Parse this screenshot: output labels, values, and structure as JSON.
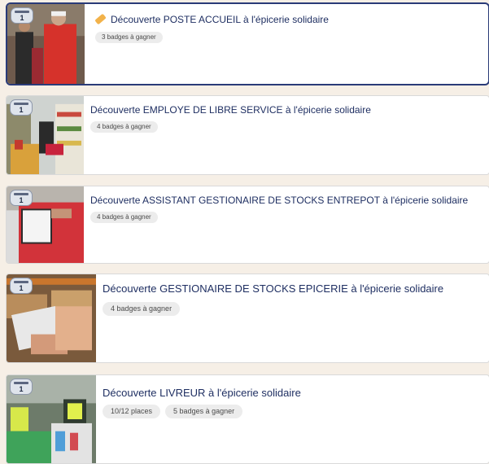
{
  "cards": [
    {
      "title": "Découverte POSTE ACCUEIL à l'épicerie solidaire",
      "session": "1",
      "chips": [
        "3 badges à gagner"
      ]
    },
    {
      "title": "Découverte EMPLOYE DE LIBRE SERVICE à l'épicerie solidaire",
      "session": "1",
      "chips": [
        "4 badges à gagner"
      ]
    },
    {
      "title": "Découverte ASSISTANT GESTIONAIRE DE STOCKS ENTREPOT à l'épicerie solidaire",
      "session": "1",
      "chips": [
        "4 badges à gagner"
      ]
    },
    {
      "title": "Découverte GESTIONAIRE DE STOCKS EPICERIE à l'épicerie solidaire",
      "session": "1",
      "chips": [
        "4 badges à gagner"
      ]
    },
    {
      "title": "Découverte LIVREUR à l'épicerie solidaire",
      "session": "1",
      "chips": [
        "10/12 places",
        "5 badges à gagner"
      ]
    }
  ],
  "colors": {
    "selected_border": "#2a3b78",
    "title": "#1f2f62",
    "background": "#f6efe6"
  }
}
